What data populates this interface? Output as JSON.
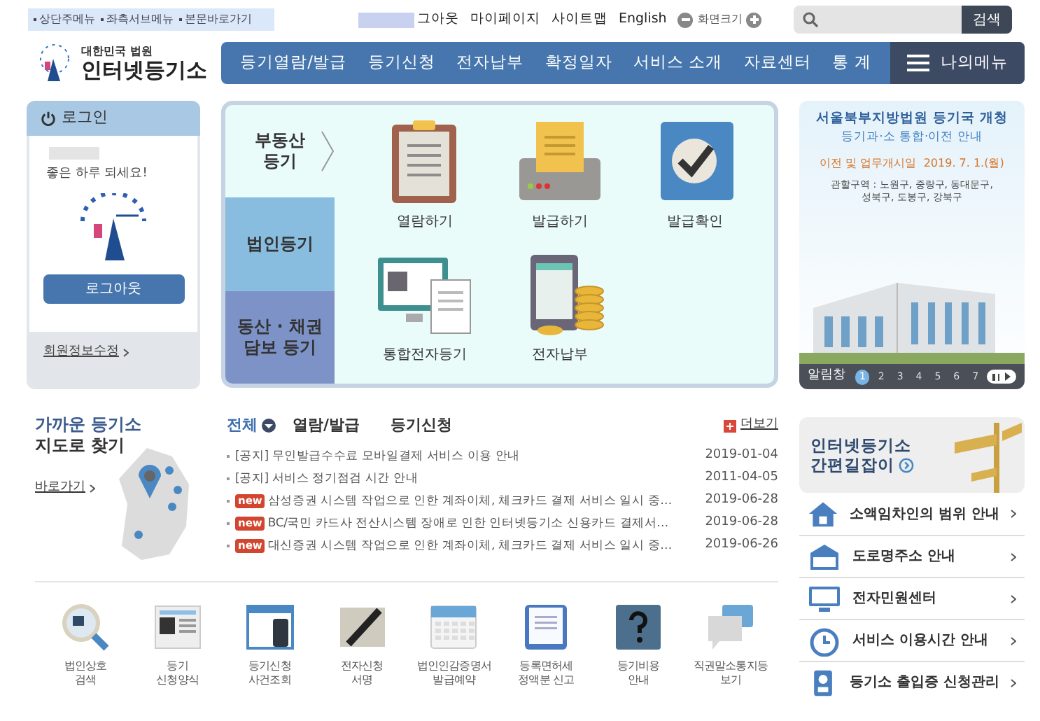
{
  "skip_links": [
    "상단주메뉴",
    "좌측서브메뉴",
    "본문바로가기"
  ],
  "top_links": [
    "그아웃",
    "마이페이지",
    "사이트맵",
    "English"
  ],
  "font_size": {
    "label": "화면크기"
  },
  "search": {
    "button": "검색"
  },
  "logo": {
    "line1": "대한민국 법원",
    "line2": "인터넷등기소"
  },
  "nav": {
    "items": [
      "등기열람/발급",
      "등기신청",
      "전자납부",
      "확정일자",
      "서비스 소개",
      "자료센터",
      "통 계"
    ],
    "my_menu": "나의메뉴"
  },
  "login": {
    "title": "로그인",
    "greeting": "좋은 하루 되세요!",
    "logout_button": "로그아웃",
    "edit_link": "회원정보수정"
  },
  "services": {
    "categories": [
      {
        "label": "부동산\n등기",
        "selected": true
      },
      {
        "label": "법인등기",
        "selected": false
      },
      {
        "label": "동산 · 채권\n담보 등기",
        "selected": false
      }
    ],
    "items": [
      {
        "label": "열람하기",
        "kind": "clipboard"
      },
      {
        "label": "발급하기",
        "kind": "printer"
      },
      {
        "label": "발급확인",
        "kind": "check"
      },
      {
        "label": "통합전자등기",
        "kind": "monitor"
      },
      {
        "label": "전자납부",
        "kind": "coins"
      }
    ]
  },
  "banner": {
    "title": "서울북부지방법원 등기국 개청",
    "subtitle": "등기과·소 통합·이전 안내",
    "date_line": "이전 및 업무개시일  2019. 7. 1.(월)",
    "area": "관할구역 : 노원구, 중랑구, 동대문구,\n성북구, 도봉구, 강북구",
    "pager_label": "알림창",
    "pages": [
      {
        "label": "1",
        "selected": true
      },
      {
        "label": "2",
        "selected": false
      },
      {
        "label": "3",
        "selected": false
      },
      {
        "label": "4",
        "selected": false
      },
      {
        "label": "5",
        "selected": false
      },
      {
        "label": "6",
        "selected": false
      },
      {
        "label": "7",
        "selected": false
      }
    ]
  },
  "map": {
    "title_1": "가까운 등기소",
    "title_2": "지도로 찾기",
    "link": "바로가기"
  },
  "notices": {
    "tabs": [
      {
        "label": "전체",
        "selected": true
      },
      {
        "label": "열람/발급",
        "selected": false
      },
      {
        "label": "등기신청",
        "selected": false
      }
    ],
    "more": "더보기",
    "rows": [
      {
        "badge": null,
        "title": "[공지] 무인발급수수료 모바일결제 서비스 이용 안내",
        "date": "2019-01-04"
      },
      {
        "badge": null,
        "title": "[공지] 서비스 정기점검 시간 안내",
        "date": "2011-04-05"
      },
      {
        "badge": "new",
        "title": "삼성증권 시스템 작업으로 인한 계좌이체, 체크카드 결제 서비스 일시 중…",
        "date": "2019-06-28"
      },
      {
        "badge": "new",
        "title": "BC/국민 카드사 전산시스템 장애로 인한 인터넷등기소 신용카드 결제서…",
        "date": "2019-06-28"
      },
      {
        "badge": "new",
        "title": "대신증권 시스템 작업으로 인한 계좌이체, 체크카드 결제 서비스 일시 중…",
        "date": "2019-06-26"
      }
    ]
  },
  "guide": {
    "line1": "인터넷등기소",
    "line2": "간편길잡이"
  },
  "quick_links": [
    {
      "label": "소액임차인의 범위 안내",
      "kind": "house"
    },
    {
      "label": "도로명주소 안내",
      "kind": "sign"
    },
    {
      "label": "전자민원센터",
      "kind": "monitor"
    },
    {
      "label": "서비스 이용시간 안내",
      "kind": "clock"
    },
    {
      "label": "등기소 출입증 신청관리",
      "kind": "badge"
    }
  ],
  "bottom_icons": [
    {
      "label": "법인상호\n검색",
      "kind": "magnifier"
    },
    {
      "label": "등기\n신청양식",
      "kind": "paper"
    },
    {
      "label": "등기신청\n사건조회",
      "kind": "window"
    },
    {
      "label": "전자신청\n서명",
      "kind": "pen"
    },
    {
      "label": "법인인감증명서\n발급예약",
      "kind": "calendar"
    },
    {
      "label": "등록면허세\n정액분 신고",
      "kind": "doc"
    },
    {
      "label": "등기비용\n안내",
      "kind": "question"
    },
    {
      "label": "직권말소통지등\n보기",
      "kind": "speech"
    }
  ]
}
